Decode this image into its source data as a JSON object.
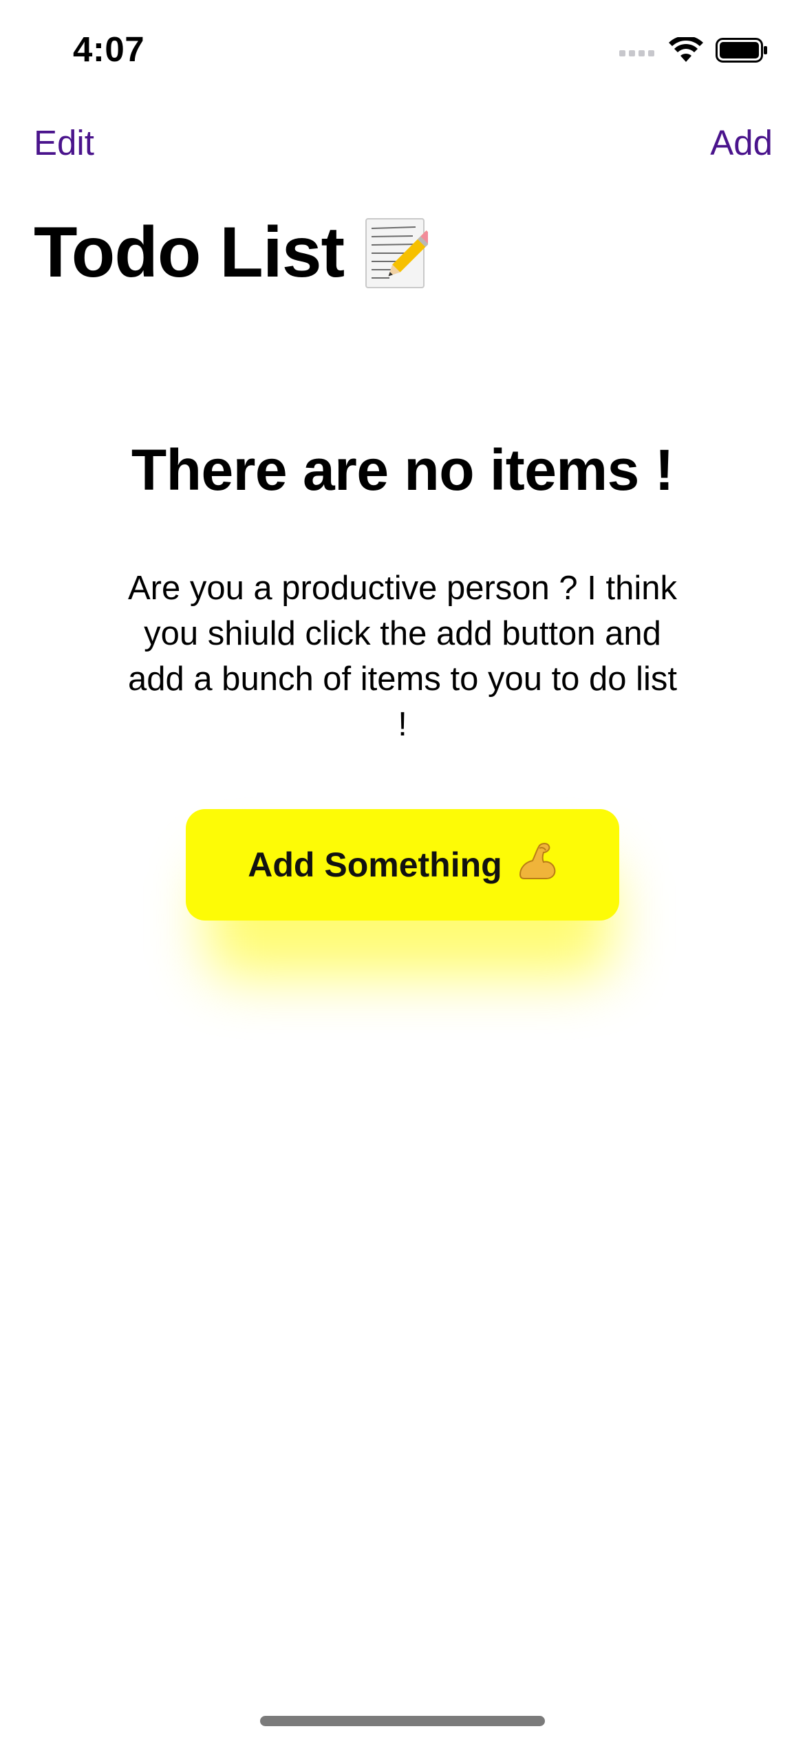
{
  "status_bar": {
    "time": "4:07",
    "icons": [
      "cellular-signal-icon",
      "wifi-icon",
      "battery-icon"
    ]
  },
  "nav": {
    "edit_label": "Edit",
    "add_label": "Add",
    "accent_color": "#4a148c"
  },
  "page": {
    "title": "Todo List",
    "title_icon": "memo-icon"
  },
  "empty_state": {
    "title": "There are no items !",
    "body": "Are you a productive person ? I think you shiuld click the add button and add a bunch of items to you to do list !",
    "cta_label": "Add Something",
    "cta_icon": "flexed-biceps-icon",
    "cta_color": "#fdfb06"
  }
}
